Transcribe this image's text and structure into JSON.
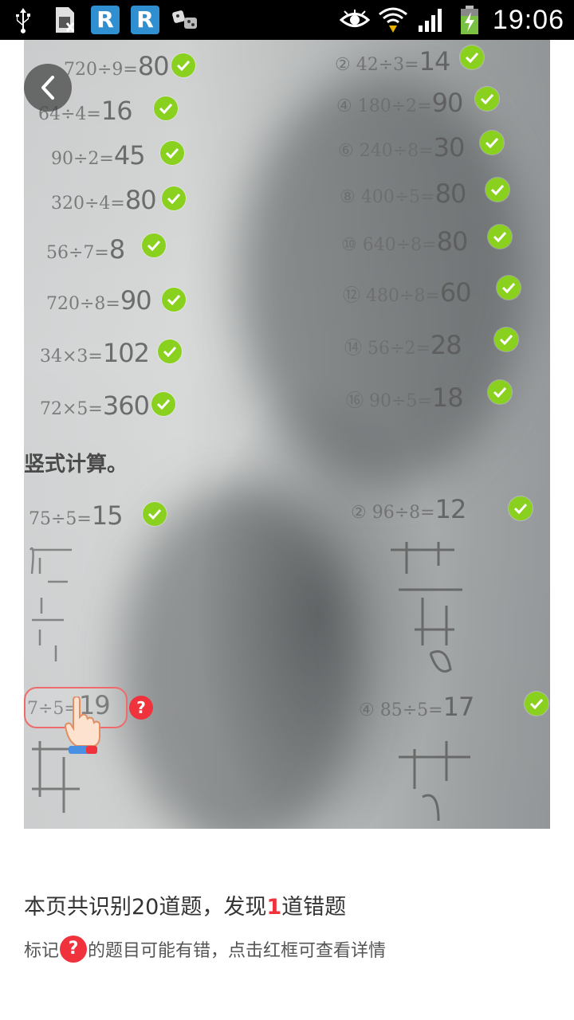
{
  "status_bar": {
    "time": "19:06",
    "box_letter_1": "R",
    "box_letter_2": "R",
    "left_icons": [
      "usb-icon",
      "sim-icon",
      "r-app-icon",
      "r-app-icon",
      "dice-icon"
    ],
    "right_icons": [
      "eye-icon",
      "wifi-icon",
      "signal-icon",
      "battery-charging-icon"
    ]
  },
  "photo": {
    "heading": "竖式计算。",
    "equations_left": [
      {
        "id": "l1",
        "text": "720÷9=",
        "answer": "80",
        "status": "correct"
      },
      {
        "id": "l2",
        "text": "64÷4=",
        "answer": "16",
        "status": "correct"
      },
      {
        "id": "l3",
        "text": "90÷2=",
        "answer": "45",
        "status": "correct"
      },
      {
        "id": "l4",
        "text": "320÷4=",
        "answer": "80",
        "status": "correct"
      },
      {
        "id": "l5",
        "text": "56÷7=",
        "answer": "8",
        "status": "correct"
      },
      {
        "id": "l6",
        "text": "720÷8=",
        "answer": "90",
        "status": "correct"
      },
      {
        "id": "l7",
        "text": "34×3=",
        "answer": "102",
        "status": "correct"
      },
      {
        "id": "l8",
        "text": "72×5=",
        "answer": "360",
        "status": "correct"
      }
    ],
    "equations_right": [
      {
        "id": "r1",
        "num": "②",
        "text": "42÷3=",
        "answer": "14",
        "status": "correct"
      },
      {
        "id": "r2",
        "num": "④",
        "text": "180÷2=",
        "answer": "90",
        "status": "correct"
      },
      {
        "id": "r3",
        "num": "⑥",
        "text": "240÷8=",
        "answer": "30",
        "status": "correct"
      },
      {
        "id": "r4",
        "num": "⑧",
        "text": "400÷5=",
        "answer": "80",
        "status": "correct"
      },
      {
        "id": "r5",
        "num": "⑩",
        "text": "640÷8=",
        "answer": "80",
        "status": "correct"
      },
      {
        "id": "r6",
        "num": "⑫",
        "text": "480÷8=",
        "answer": "60",
        "status": "correct"
      },
      {
        "id": "r7",
        "num": "⑭",
        "text": "56÷2=",
        "answer": "28",
        "status": "correct"
      },
      {
        "id": "r8",
        "num": "⑯",
        "text": "90÷5=",
        "answer": "18",
        "status": "correct"
      }
    ],
    "vertical_calcs": [
      {
        "id": "v1",
        "text": "75÷5=",
        "answer": "15",
        "status": "correct"
      },
      {
        "id": "v2",
        "num": "②",
        "text": "96÷8=",
        "answer": "12",
        "status": "correct"
      },
      {
        "id": "v3",
        "text": "7÷5=",
        "answer": "19",
        "status": "error"
      },
      {
        "id": "v4",
        "num": "④",
        "text": "85÷5=",
        "answer": "17",
        "status": "correct"
      }
    ]
  },
  "summary": {
    "title_prefix": "本页共识别20道题，发现",
    "error_count": "1",
    "title_suffix": "道错题",
    "sub_prefix": "标记",
    "sub_mark": "?",
    "sub_suffix": "的题目可能有错，点击红框可查看详情"
  },
  "colors": {
    "correct": "#8ad11f",
    "error": "#f0323c",
    "status_bar": "#000000"
  }
}
